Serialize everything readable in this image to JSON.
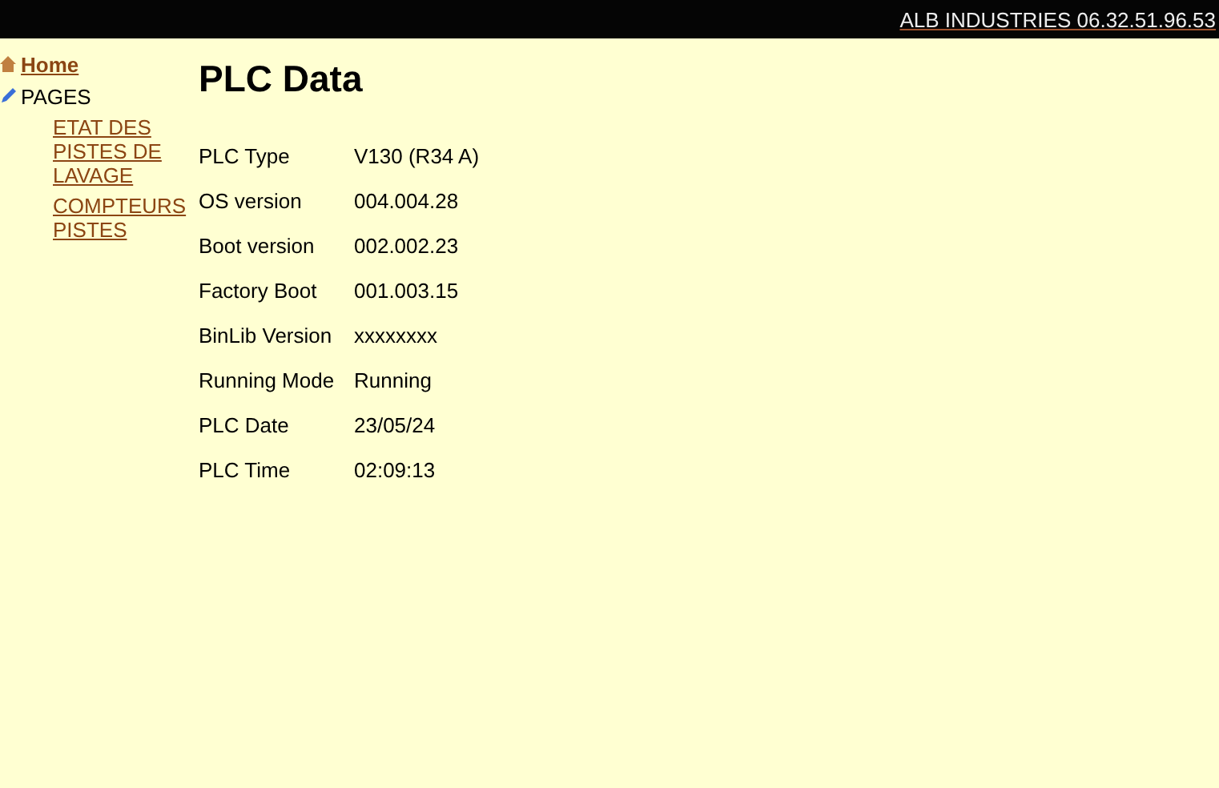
{
  "header": {
    "link": "ALB INDUSTRIES 06.32.51.96.53"
  },
  "sidebar": {
    "items": [
      {
        "label": "Home",
        "kind": "home"
      },
      {
        "label": "PAGES",
        "kind": "folder",
        "children": [
          {
            "label": "ETAT DES PISTES DE LAVAGE"
          },
          {
            "label": "COMPTEURS PISTES"
          }
        ]
      }
    ]
  },
  "title": "PLC Data",
  "table": {
    "rows": [
      {
        "label": "PLC Type",
        "value": "V130 (R34 A)"
      },
      {
        "label": "OS version",
        "value": "004.004.28"
      },
      {
        "label": "Boot version",
        "value": "002.002.23"
      },
      {
        "label": "Factory Boot",
        "value": "001.003.15"
      },
      {
        "label": "BinLib Version",
        "value": "xxxxxxxx"
      },
      {
        "label": "Running Mode",
        "value": "Running"
      },
      {
        "label": "PLC Date",
        "value": "23/05/24"
      },
      {
        "label": "PLC Time",
        "value": "02:09:13"
      }
    ]
  }
}
